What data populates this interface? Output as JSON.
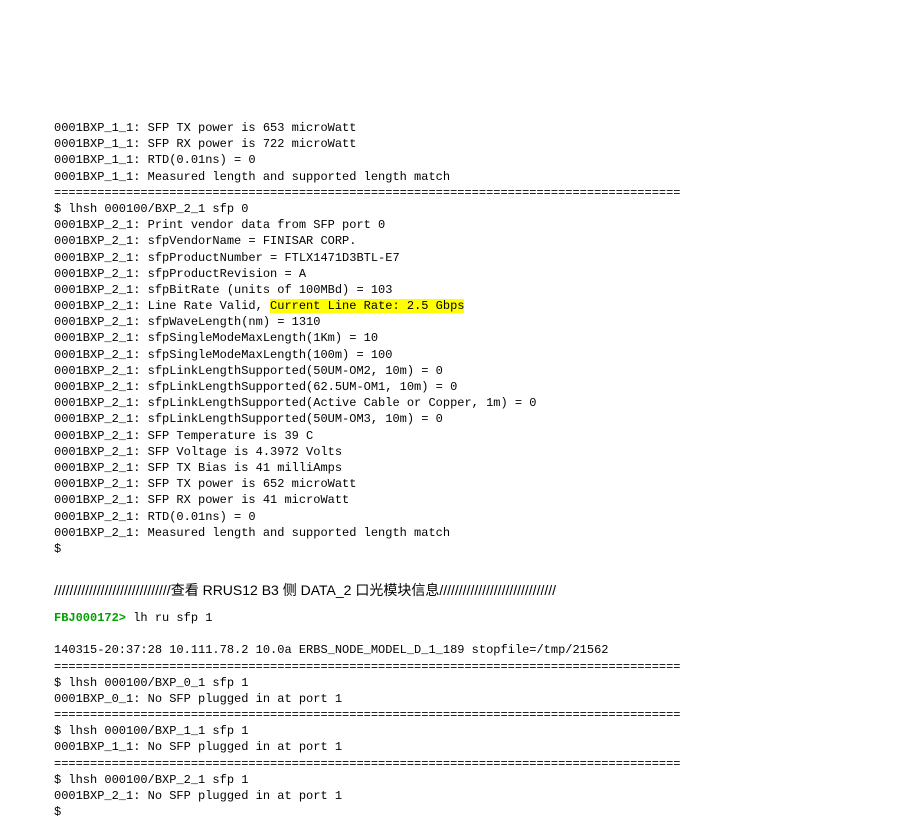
{
  "top_block": {
    "l1": "0001BXP_1_1: SFP TX power is 653 microWatt",
    "l2": "0001BXP_1_1: SFP RX power is 722 microWatt",
    "l3": "0001BXP_1_1: RTD(0.01ns) = 0",
    "l4": "0001BXP_1_1: Measured length and supported length match",
    "sep": "======================================================================================="
  },
  "bxp21": {
    "cmd": "$ lhsh 000100/BXP_2_1 sfp 0",
    "l1": "0001BXP_2_1: Print vendor data from SFP port 0",
    "l2": "0001BXP_2_1: sfpVendorName = FINISAR CORP.",
    "l3": "0001BXP_2_1: sfpProductNumber = FTLX1471D3BTL-E7",
    "l4": "0001BXP_2_1: sfpProductRevision = A",
    "l5": "0001BXP_2_1: sfpBitRate (units of 100MBd) = 103",
    "l6a": "0001BXP_2_1: Line Rate Valid, ",
    "l6h": "Current Line Rate: 2.5 Gbps",
    "l7": "0001BXP_2_1: sfpWaveLength(nm) = 1310",
    "l8": "0001BXP_2_1: sfpSingleModeMaxLength(1Km) = 10",
    "l9": "0001BXP_2_1: sfpSingleModeMaxLength(100m) = 100",
    "l10": "0001BXP_2_1: sfpLinkLengthSupported(50UM-OM2, 10m) = 0",
    "l11": "0001BXP_2_1: sfpLinkLengthSupported(62.5UM-OM1, 10m) = 0",
    "l12": "0001BXP_2_1: sfpLinkLengthSupported(Active Cable or Copper, 1m) = 0",
    "l13": "0001BXP_2_1: sfpLinkLengthSupported(50UM-OM3, 10m) = 0",
    "l14": "0001BXP_2_1: SFP Temperature is 39 C",
    "l15": "0001BXP_2_1: SFP Voltage is 4.3972 Volts",
    "l16": "0001BXP_2_1: SFP TX Bias is 41 milliAmps",
    "l17": "0001BXP_2_1: SFP TX power is 652 microWatt",
    "l18": "0001BXP_2_1: SFP RX power is 41 microWatt",
    "l19": "0001BXP_2_1: RTD(0.01ns) = 0",
    "l20": "0001BXP_2_1: Measured length and supported length match",
    "end": "$"
  },
  "section_title": "//////////////////////////////查看 RRUS12 B3 侧 DATA_2 口光模块信息//////////////////////////////",
  "second": {
    "prompt_green": "FBJ000172>",
    "prompt_rest": " lh ru sfp 1",
    "blank": " ",
    "ts": "140315-20:37:28 10.111.78.2 10.0a ERBS_NODE_MODEL_D_1_189 stopfile=/tmp/21562",
    "sep": "=======================================================================================",
    "cmd0": "$ lhsh 000100/BXP_0_1 sfp 1",
    "msg0": "0001BXP_0_1: No SFP plugged in at port 1",
    "cmd1": "$ lhsh 000100/BXP_1_1 sfp 1",
    "msg1": "0001BXP_1_1: No SFP plugged in at port 1",
    "cmd2": "$ lhsh 000100/BXP_2_1 sfp 1",
    "msg2": "0001BXP_2_1: No SFP plugged in at port 1",
    "end": "$"
  }
}
